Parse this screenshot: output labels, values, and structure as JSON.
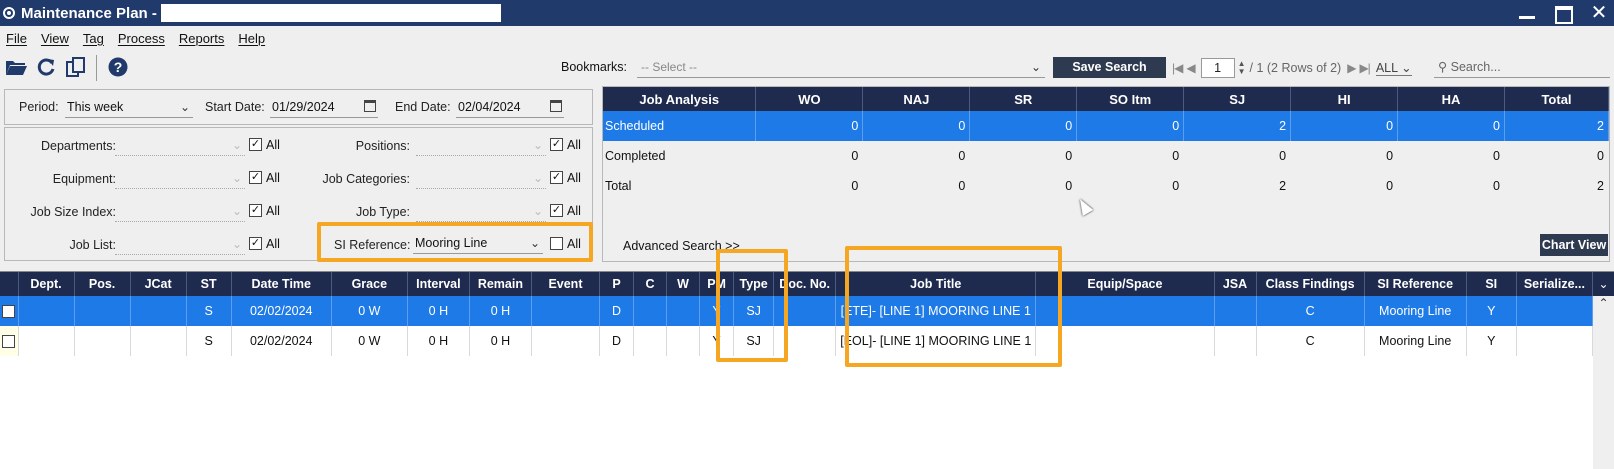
{
  "window": {
    "title": "Maintenance Plan -"
  },
  "menu": [
    "File",
    "View",
    "Tag",
    "Process",
    "Reports",
    "Help"
  ],
  "toolbar": {
    "icons": [
      "folder-icon",
      "refresh-icon",
      "copy-icon",
      "help-icon"
    ],
    "bookmarks_label": "Bookmarks:",
    "bookmarks_placeholder": "-- Select --",
    "save_search": "Save Search",
    "page": "1",
    "page_info": "/  1 (2 Rows of 2)",
    "rows_filter": "ALL",
    "search_placeholder": "Search..."
  },
  "period": {
    "label": "Period:",
    "value": "This week",
    "start_label": "Start Date:",
    "start_value": "01/29/2024",
    "end_label": "End Date:",
    "end_value": "02/04/2024"
  },
  "filters": {
    "departments": "Departments:",
    "equipment": "Equipment:",
    "job_size_index": "Job Size Index:",
    "job_list": "Job List:",
    "positions": "Positions:",
    "job_categories": "Job Categories:",
    "job_type": "Job Type:",
    "si_reference": "SI Reference:",
    "si_reference_value": "Mooring Line",
    "all": "All"
  },
  "analysis": {
    "headers": [
      "Job Analysis",
      "WO",
      "NAJ",
      "SR",
      "SO Itm",
      "SJ",
      "HI",
      "HA",
      "Total"
    ],
    "rows": [
      {
        "label": "Scheduled",
        "values": [
          "0",
          "0",
          "0",
          "0",
          "2",
          "0",
          "0",
          "2"
        ]
      },
      {
        "label": "Completed",
        "values": [
          "0",
          "0",
          "0",
          "0",
          "0",
          "0",
          "0",
          "0"
        ]
      },
      {
        "label": "Total",
        "values": [
          "0",
          "0",
          "0",
          "0",
          "2",
          "0",
          "0",
          "2"
        ]
      }
    ],
    "advanced_search": "Advanced Search >>",
    "chart_view": "Chart View"
  },
  "grid": {
    "headers": [
      "",
      "Dept.",
      "Pos.",
      "JCat",
      "ST",
      "Date Time",
      "Grace",
      "Interval",
      "Remain",
      "Event",
      "P",
      "C",
      "W",
      "PM",
      "Type",
      "Doc. No.",
      "Job Title",
      "Equip/Space",
      "JSA",
      "Class Findings",
      "SI Reference",
      "SI",
      "Serialize..."
    ],
    "rows": [
      [
        "",
        "",
        "",
        "",
        "S",
        "02/02/2024",
        "0 W",
        "0 H",
        "0 H",
        "",
        "D",
        "",
        "",
        "Y",
        "SJ",
        "",
        "[ETE]- [LINE 1] MOORING LINE 1",
        "",
        "",
        "C",
        "Mooring Line",
        "Y",
        ""
      ],
      [
        "",
        "",
        "",
        "",
        "S",
        "02/02/2024",
        "0 W",
        "0 H",
        "0 H",
        "",
        "D",
        "",
        "",
        "Y",
        "SJ",
        "",
        "[EOL]- [LINE 1] MOORING LINE 1",
        "",
        "",
        "C",
        "Mooring Line",
        "Y",
        ""
      ]
    ]
  },
  "colors": {
    "titlebar": "#1f3a6b",
    "header": "#1f2b4e",
    "selection": "#1e7ae6",
    "highlight": "#f5a623"
  }
}
